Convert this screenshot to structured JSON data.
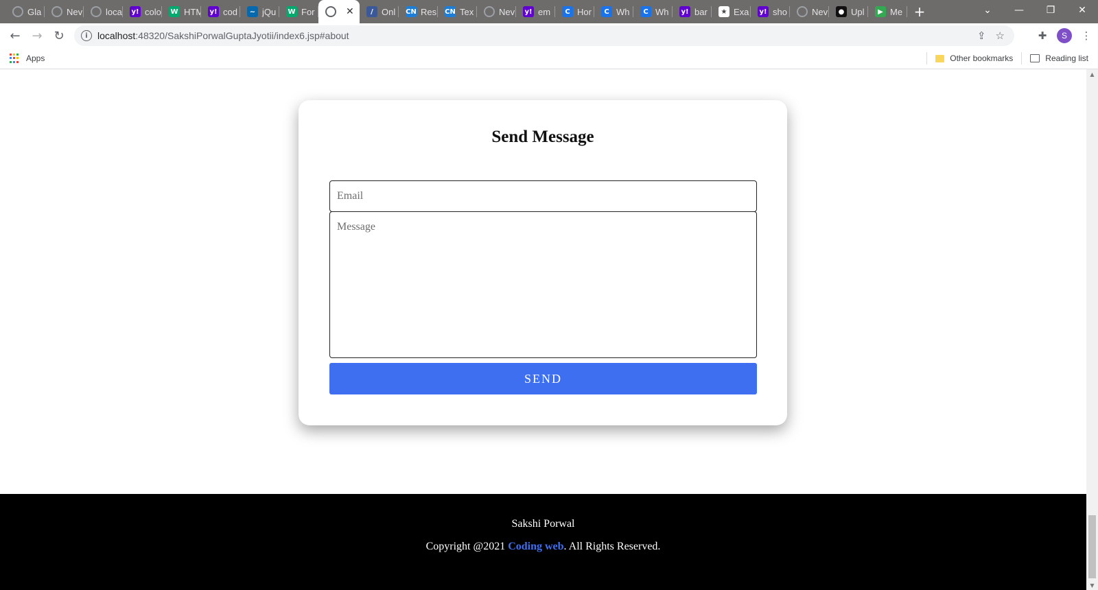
{
  "browser": {
    "tabs": [
      {
        "label": "Gla",
        "icon": "globe-icon",
        "color": "#9aa0a6",
        "glyph": ""
      },
      {
        "label": "Nev",
        "icon": "globe-icon",
        "color": "#9aa0a6",
        "glyph": ""
      },
      {
        "label": "loca",
        "icon": "globe-icon",
        "color": "#9aa0a6",
        "glyph": ""
      },
      {
        "label": "colo",
        "icon": "yahoo-icon",
        "color": "#6001d2",
        "glyph": "y!"
      },
      {
        "label": "HTM",
        "icon": "w3schools-icon",
        "color": "#04aa6d",
        "glyph": "W"
      },
      {
        "label": "cod",
        "icon": "yahoo-icon",
        "color": "#6001d2",
        "glyph": "y!"
      },
      {
        "label": "jQu",
        "icon": "jquery-icon",
        "color": "#0769ad",
        "glyph": "~"
      },
      {
        "label": "For",
        "icon": "w3schools-icon",
        "color": "#04aa6d",
        "glyph": "W"
      },
      {
        "label": "",
        "icon": "globe-icon",
        "color": "#5f6368",
        "glyph": "",
        "active": true
      },
      {
        "label": "Onl",
        "icon": "pen-icon",
        "color": "#3b5998",
        "glyph": "/"
      },
      {
        "label": "Res",
        "icon": "codingninjas-icon",
        "color": "#1c7ed6",
        "glyph": "CN"
      },
      {
        "label": "Tex",
        "icon": "codingninjas-icon",
        "color": "#1c7ed6",
        "glyph": "CN"
      },
      {
        "label": "Nev",
        "icon": "globe-icon",
        "color": "#9aa0a6",
        "glyph": ""
      },
      {
        "label": "em",
        "icon": "yahoo-icon",
        "color": "#6001d2",
        "glyph": "y!"
      },
      {
        "label": "Hor",
        "icon": "c-icon",
        "color": "#1a73e8",
        "glyph": "C"
      },
      {
        "label": "Wh",
        "icon": "c-icon",
        "color": "#1a73e8",
        "glyph": "C"
      },
      {
        "label": "Wh",
        "icon": "c-icon",
        "color": "#1a73e8",
        "glyph": "C"
      },
      {
        "label": "bar",
        "icon": "yahoo-icon",
        "color": "#6001d2",
        "glyph": "y!"
      },
      {
        "label": "Exa",
        "icon": "star-icon",
        "color": "#ffffff",
        "glyph": "★"
      },
      {
        "label": "sho",
        "icon": "yahoo-icon",
        "color": "#6001d2",
        "glyph": "y!"
      },
      {
        "label": "Nev",
        "icon": "globe-icon",
        "color": "#9aa0a6",
        "glyph": ""
      },
      {
        "label": "Upl",
        "icon": "github-icon",
        "color": "#111111",
        "glyph": "●"
      },
      {
        "label": "Me",
        "icon": "meet-icon",
        "color": "#34a853",
        "glyph": "▶"
      }
    ],
    "url_host": "localhost",
    "url_path": ":48320/SakshiPorwalGuptaJyotii/index6.jsp#about",
    "profile_initial": "S",
    "apps_label": "Apps",
    "other_bookmarks": "Other bookmarks",
    "reading_list": "Reading list"
  },
  "form": {
    "title": "Send Message",
    "email_placeholder": "Email",
    "email_value": "",
    "message_placeholder": "Message",
    "message_value": "",
    "send_label": "SEND"
  },
  "footer": {
    "name": "Sakshi Porwal",
    "copyright_prefix": "Copyright @2021 ",
    "link_text": "Coding web",
    "copyright_suffix": ". All Rights Reserved."
  },
  "colors": {
    "accent": "#3e6ff0",
    "tabstrip": "#6e6b6b",
    "footer_bg": "#000000"
  }
}
